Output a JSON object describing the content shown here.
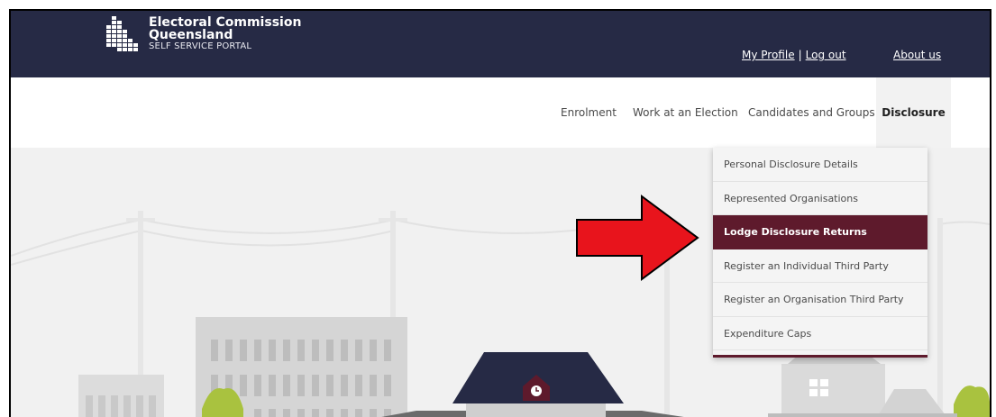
{
  "header": {
    "logo_line1": "Electoral Commission",
    "logo_line2": "Queensland",
    "logo_line3": "SELF SERVICE PORTAL",
    "my_profile": "My Profile",
    "separator": "|",
    "log_out": "Log out",
    "about_us": "About us"
  },
  "nav": {
    "items": [
      {
        "label": "Enrolment"
      },
      {
        "label": "Work at an Election"
      },
      {
        "label": "Candidates and Groups"
      },
      {
        "label": "Disclosure",
        "active": true
      }
    ]
  },
  "dropdown": {
    "items": [
      {
        "label": "Personal Disclosure Details"
      },
      {
        "label": "Represented Organisations"
      },
      {
        "label": "Lodge Disclosure Returns",
        "selected": true
      },
      {
        "label": "Register an Individual Third Party"
      },
      {
        "label": "Register an Organisation Third Party"
      },
      {
        "label": "Expenditure Caps"
      }
    ]
  },
  "colors": {
    "header_bg": "#262a45",
    "accent_maroon": "#5e1a2c",
    "arrow_red": "#e8141c"
  },
  "icons": {
    "logo": "ecq-logo-icon",
    "annotation": "red-arrow-icon"
  }
}
